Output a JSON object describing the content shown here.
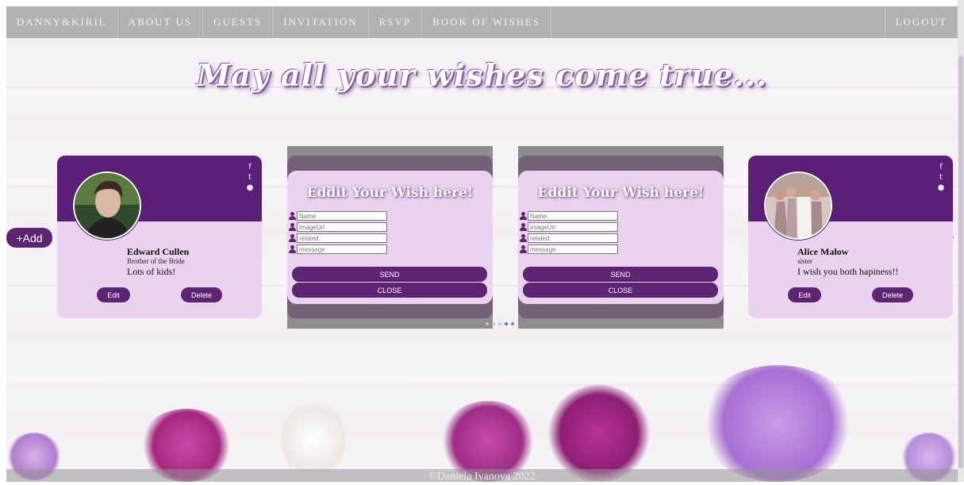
{
  "nav": {
    "items": [
      "DANNY&KIRIL",
      "ABOUT US",
      "GUESTS",
      "INVITATION",
      "RSVP",
      "BOOK OF WISHES"
    ],
    "logout": "LOGOUT"
  },
  "headline": "May all your wishes come true...",
  "add_label": "+Add",
  "cards": [
    {
      "name": "Edward Cullen",
      "relation": "Brother of the Bride",
      "message": "Lots of kids!",
      "edit_label": "Edit",
      "delete_label": "Delete"
    },
    {
      "name": "Alice Malow",
      "relation": "sister",
      "message": "I wish you both hapiness!!",
      "edit_label": "Edit",
      "delete_label": "Delete"
    }
  ],
  "edit_forms": [
    {
      "title": "Eddit Your Wish here!",
      "placeholders": [
        "Name",
        "imageUrl",
        "related",
        "message"
      ],
      "send_label": "SEND",
      "close_label": "CLOSE"
    },
    {
      "title": "Eddit Your Wish here!",
      "placeholders": [
        "Name",
        "imageUrl",
        "related",
        "message"
      ],
      "send_label": "SEND",
      "close_label": "CLOSE"
    }
  ],
  "footer": "©Daniela Ivanova 2022",
  "colors": {
    "nav_bg": "#b3b1b1",
    "purple_dark": "#5c1f79",
    "card_bg": "#e9d3ee",
    "arrow": "#3b7bd0"
  },
  "icons": [
    "facebook-icon",
    "twitter-icon",
    "github-icon",
    "user-icon",
    "chevron-left-icon",
    "chevron-right-icon"
  ]
}
